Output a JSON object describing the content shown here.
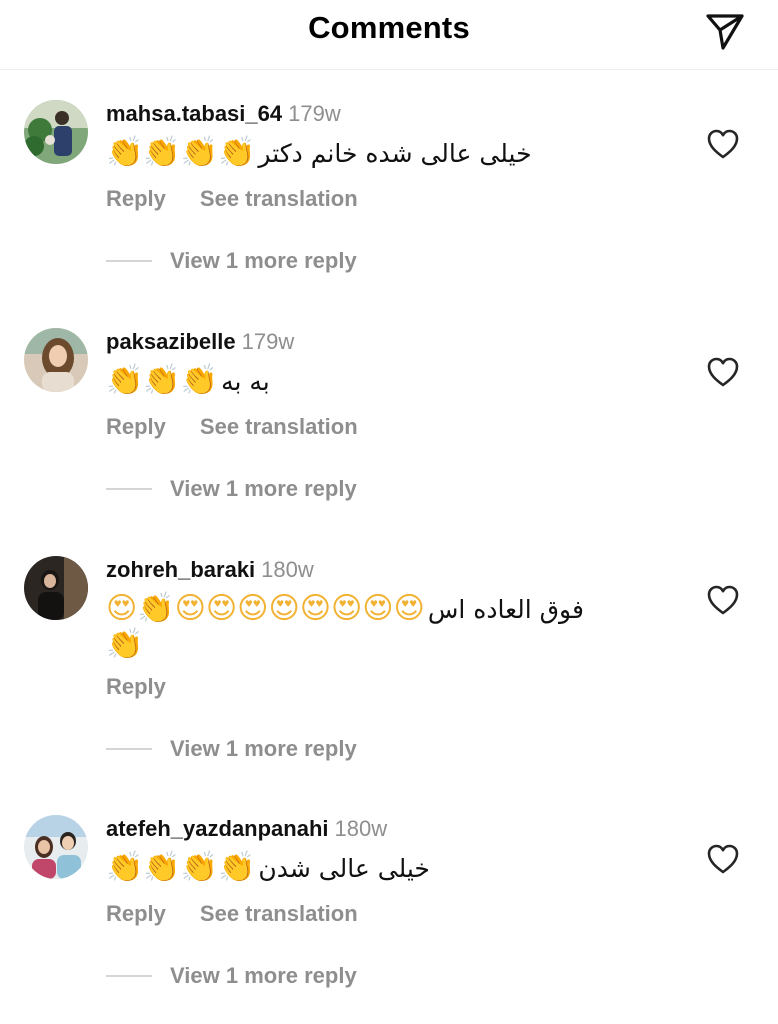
{
  "header": {
    "title": "Comments",
    "share_icon": "paper-plane-icon"
  },
  "comments": [
    {
      "username": "mahsa.tabasi_64",
      "time": "179w",
      "text": "خیلی عالی شده خانم دکتر",
      "emoji": "👏👏👏👏",
      "reply_label": "Reply",
      "translate_label": "See translation",
      "view_more": "View 1 more reply"
    },
    {
      "username": "paksazibelle",
      "time": "179w",
      "text": "به به",
      "emoji": "👏👏👏",
      "reply_label": "Reply",
      "translate_label": "See translation",
      "view_more": "View 1 more reply"
    },
    {
      "username": "zohreh_baraki",
      "time": "180w",
      "text": "فوق العاده اس",
      "emoji": "😍👏😍😍😍😍😍😍😍😍",
      "emoji_line2": "👏",
      "reply_label": "Reply",
      "view_more": "View 1 more reply"
    },
    {
      "username": "atefeh_yazdanpanahi",
      "time": "180w",
      "text": "خیلی عالی شدن",
      "emoji": "👏👏👏👏",
      "reply_label": "Reply",
      "translate_label": "See translation",
      "view_more": "View 1 more reply"
    }
  ],
  "icons": {
    "like": "heart-outline-icon"
  }
}
